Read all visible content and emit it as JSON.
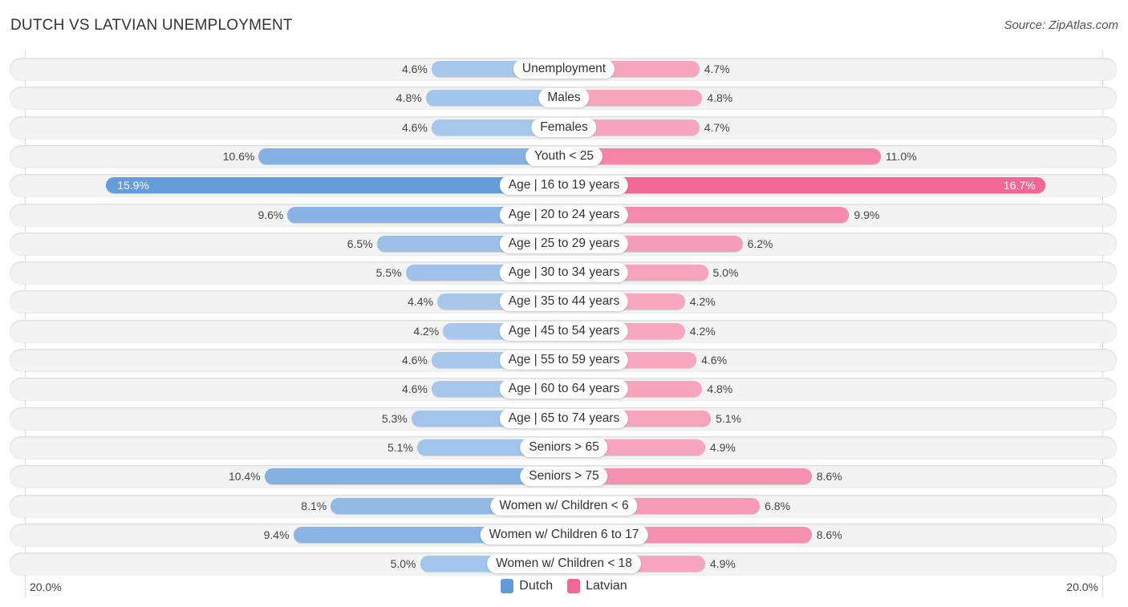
{
  "header": {
    "title": "DUTCH VS LATVIAN UNEMPLOYMENT",
    "source": "Source: ZipAtlas.com"
  },
  "colors": {
    "dutch_strong": "#6199d9",
    "dutch_light": "#a9c8ec",
    "latvian_strong": "#f06895",
    "latvian_light": "#f7a9c1"
  },
  "chart_data": {
    "type": "bar",
    "orientation": "horizontal-diverging",
    "title": "DUTCH VS LATVIAN UNEMPLOYMENT",
    "xlabel": "",
    "ylabel": "",
    "xlim": [
      -20.0,
      20.0
    ],
    "axis_min_label": "20.0%",
    "axis_max_label": "20.0%",
    "legend_position": "bottom-center",
    "grid": false,
    "categories": [
      "Unemployment",
      "Males",
      "Females",
      "Youth < 25",
      "Age | 16 to 19 years",
      "Age | 20 to 24 years",
      "Age | 25 to 29 years",
      "Age | 30 to 34 years",
      "Age | 35 to 44 years",
      "Age | 45 to 54 years",
      "Age | 55 to 59 years",
      "Age | 60 to 64 years",
      "Age | 65 to 74 years",
      "Seniors > 65",
      "Seniors > 75",
      "Women w/ Children < 6",
      "Women w/ Children 6 to 17",
      "Women w/ Children < 18"
    ],
    "series": [
      {
        "name": "Dutch",
        "side": "left",
        "values": [
          4.6,
          4.8,
          4.6,
          10.6,
          15.9,
          9.6,
          6.5,
          5.5,
          4.4,
          4.2,
          4.6,
          4.6,
          5.3,
          5.1,
          10.4,
          8.1,
          9.4,
          5.0
        ]
      },
      {
        "name": "Latvian",
        "side": "right",
        "values": [
          4.7,
          4.8,
          4.7,
          11.0,
          16.7,
          9.9,
          6.2,
          5.0,
          4.2,
          4.2,
          4.6,
          4.8,
          5.1,
          4.9,
          8.6,
          6.8,
          8.6,
          4.9
        ]
      }
    ],
    "value_suffix": "%"
  }
}
